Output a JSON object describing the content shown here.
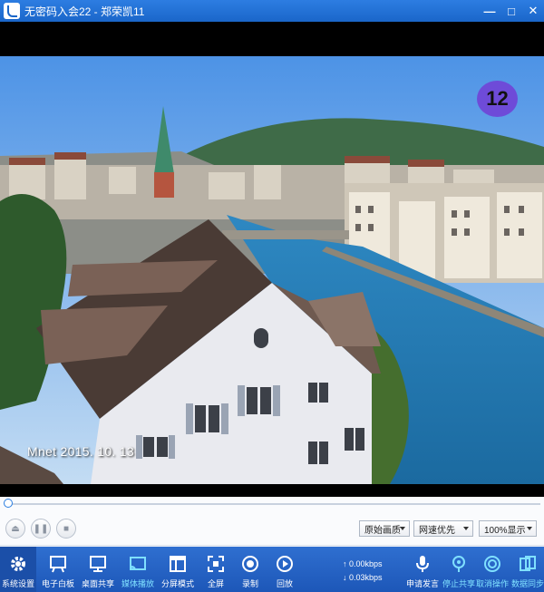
{
  "window": {
    "title": "无密码入会22 - 郑荣凯11",
    "minimize": "—",
    "maximize": "□",
    "close": "✕"
  },
  "video": {
    "overlay_text": "Mnet 2015. 10. 13",
    "user_number": "12"
  },
  "playback": {
    "progress_percent": 0,
    "quality": "原始画质",
    "network": "网速优先",
    "zoom": "100%显示"
  },
  "toolbar": {
    "items": [
      {
        "label": "系统设置",
        "icon": "gear-icon"
      },
      {
        "label": "电子白板",
        "icon": "whiteboard-icon"
      },
      {
        "label": "桌面共享",
        "icon": "desktop-share-icon"
      },
      {
        "label": "媒体播放",
        "icon": "media-cast-icon"
      },
      {
        "label": "分屏模式",
        "icon": "split-screen-icon"
      },
      {
        "label": "全屏",
        "icon": "fullscreen-icon"
      },
      {
        "label": "录制",
        "icon": "record-icon"
      },
      {
        "label": "回放",
        "icon": "playback-icon"
      },
      {
        "label": "申请发言",
        "icon": "microphone-icon"
      },
      {
        "label": "停止共享",
        "icon": "stop-share-icon"
      },
      {
        "label": "取消操作",
        "icon": "cancel-icon"
      },
      {
        "label": "数据同步",
        "icon": "sync-icon"
      }
    ],
    "upload": "↑ 0.00kbps",
    "download": "↓ 0.03kbps"
  },
  "colors": {
    "titlebar": "#1a66c9",
    "toolbar": "#1d57b8",
    "active_label": "#7fe0ff",
    "badge": "#6e4bd8"
  }
}
